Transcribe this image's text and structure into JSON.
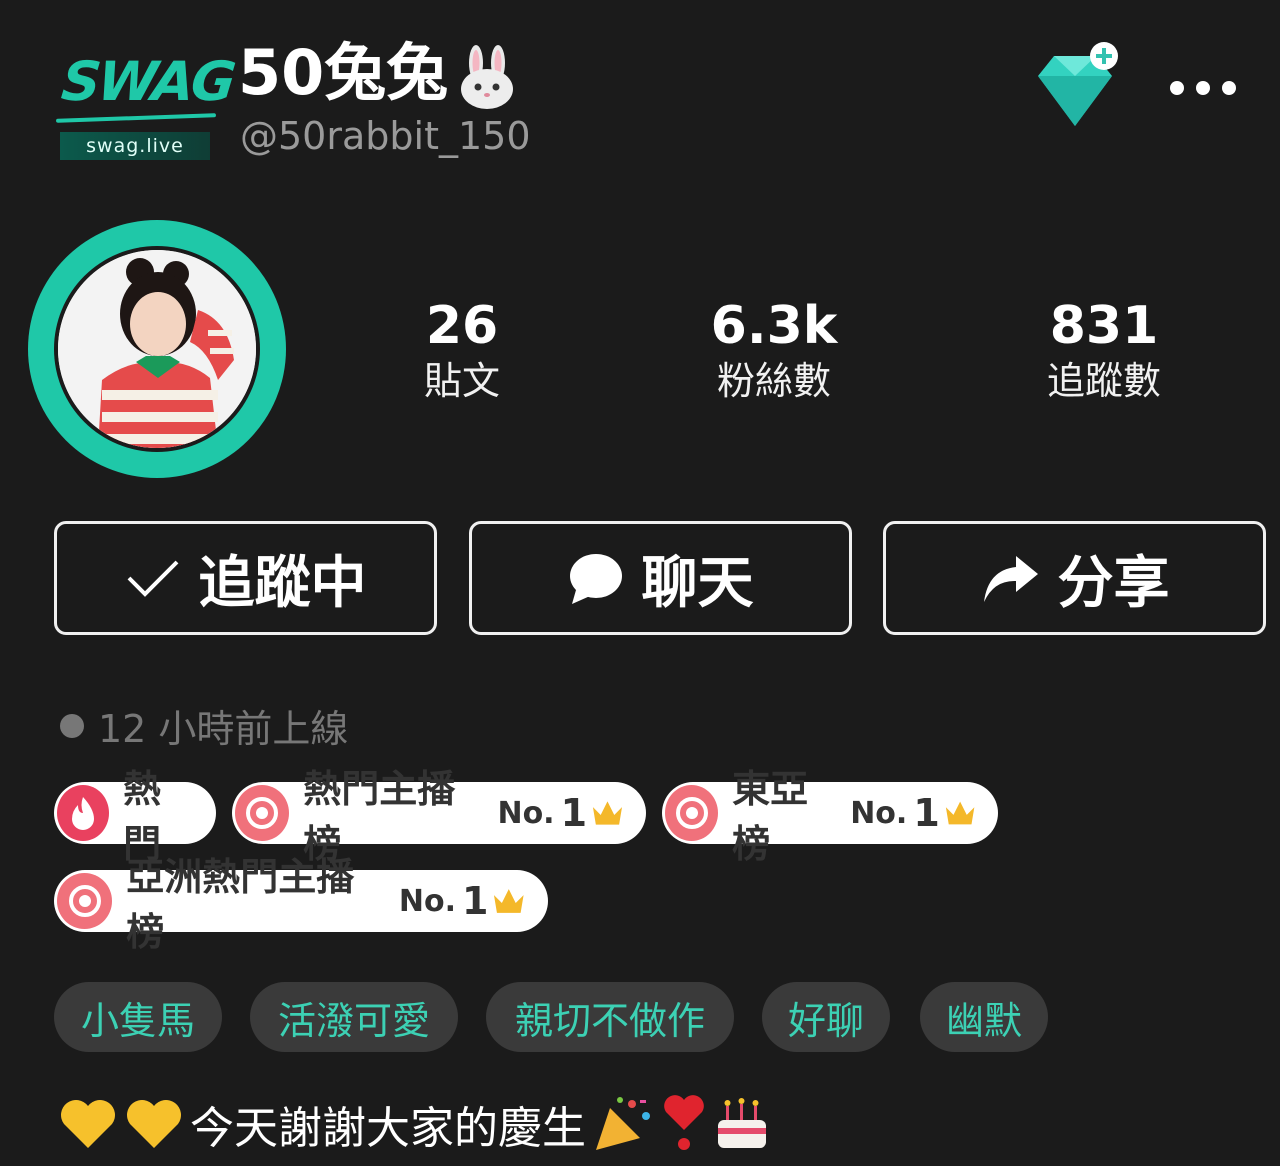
{
  "logo": {
    "wordmark": "SWAG",
    "domain": "swag.live"
  },
  "profile": {
    "name": "50兔兔",
    "handle": "@50rabbit_150"
  },
  "stats": [
    {
      "value": "26",
      "label": "貼文"
    },
    {
      "value": "6.3k",
      "label": "粉絲數"
    },
    {
      "value": "831",
      "label": "追蹤數"
    }
  ],
  "actions": {
    "follow": "追蹤中",
    "chat": "聊天",
    "share": "分享"
  },
  "online_status": "12 小時前上線",
  "badges": [
    {
      "label": "熱門"
    },
    {
      "label": "熱門主播榜",
      "rank_prefix": "No.",
      "rank": "1"
    },
    {
      "label": "東亞榜",
      "rank_prefix": "No.",
      "rank": "1"
    },
    {
      "label": "亞洲熱門主播榜",
      "rank_prefix": "No.",
      "rank": "1"
    }
  ],
  "tags": [
    "小隻馬",
    "活潑可愛",
    "親切不做作",
    "好聊",
    "幽默"
  ],
  "bio": "今天謝謝大家的慶生",
  "colors": {
    "accent": "#1fc8a8",
    "tag_text": "#3cd1b4",
    "badge_icon": "#f0717b",
    "background": "#1b1b1b"
  }
}
